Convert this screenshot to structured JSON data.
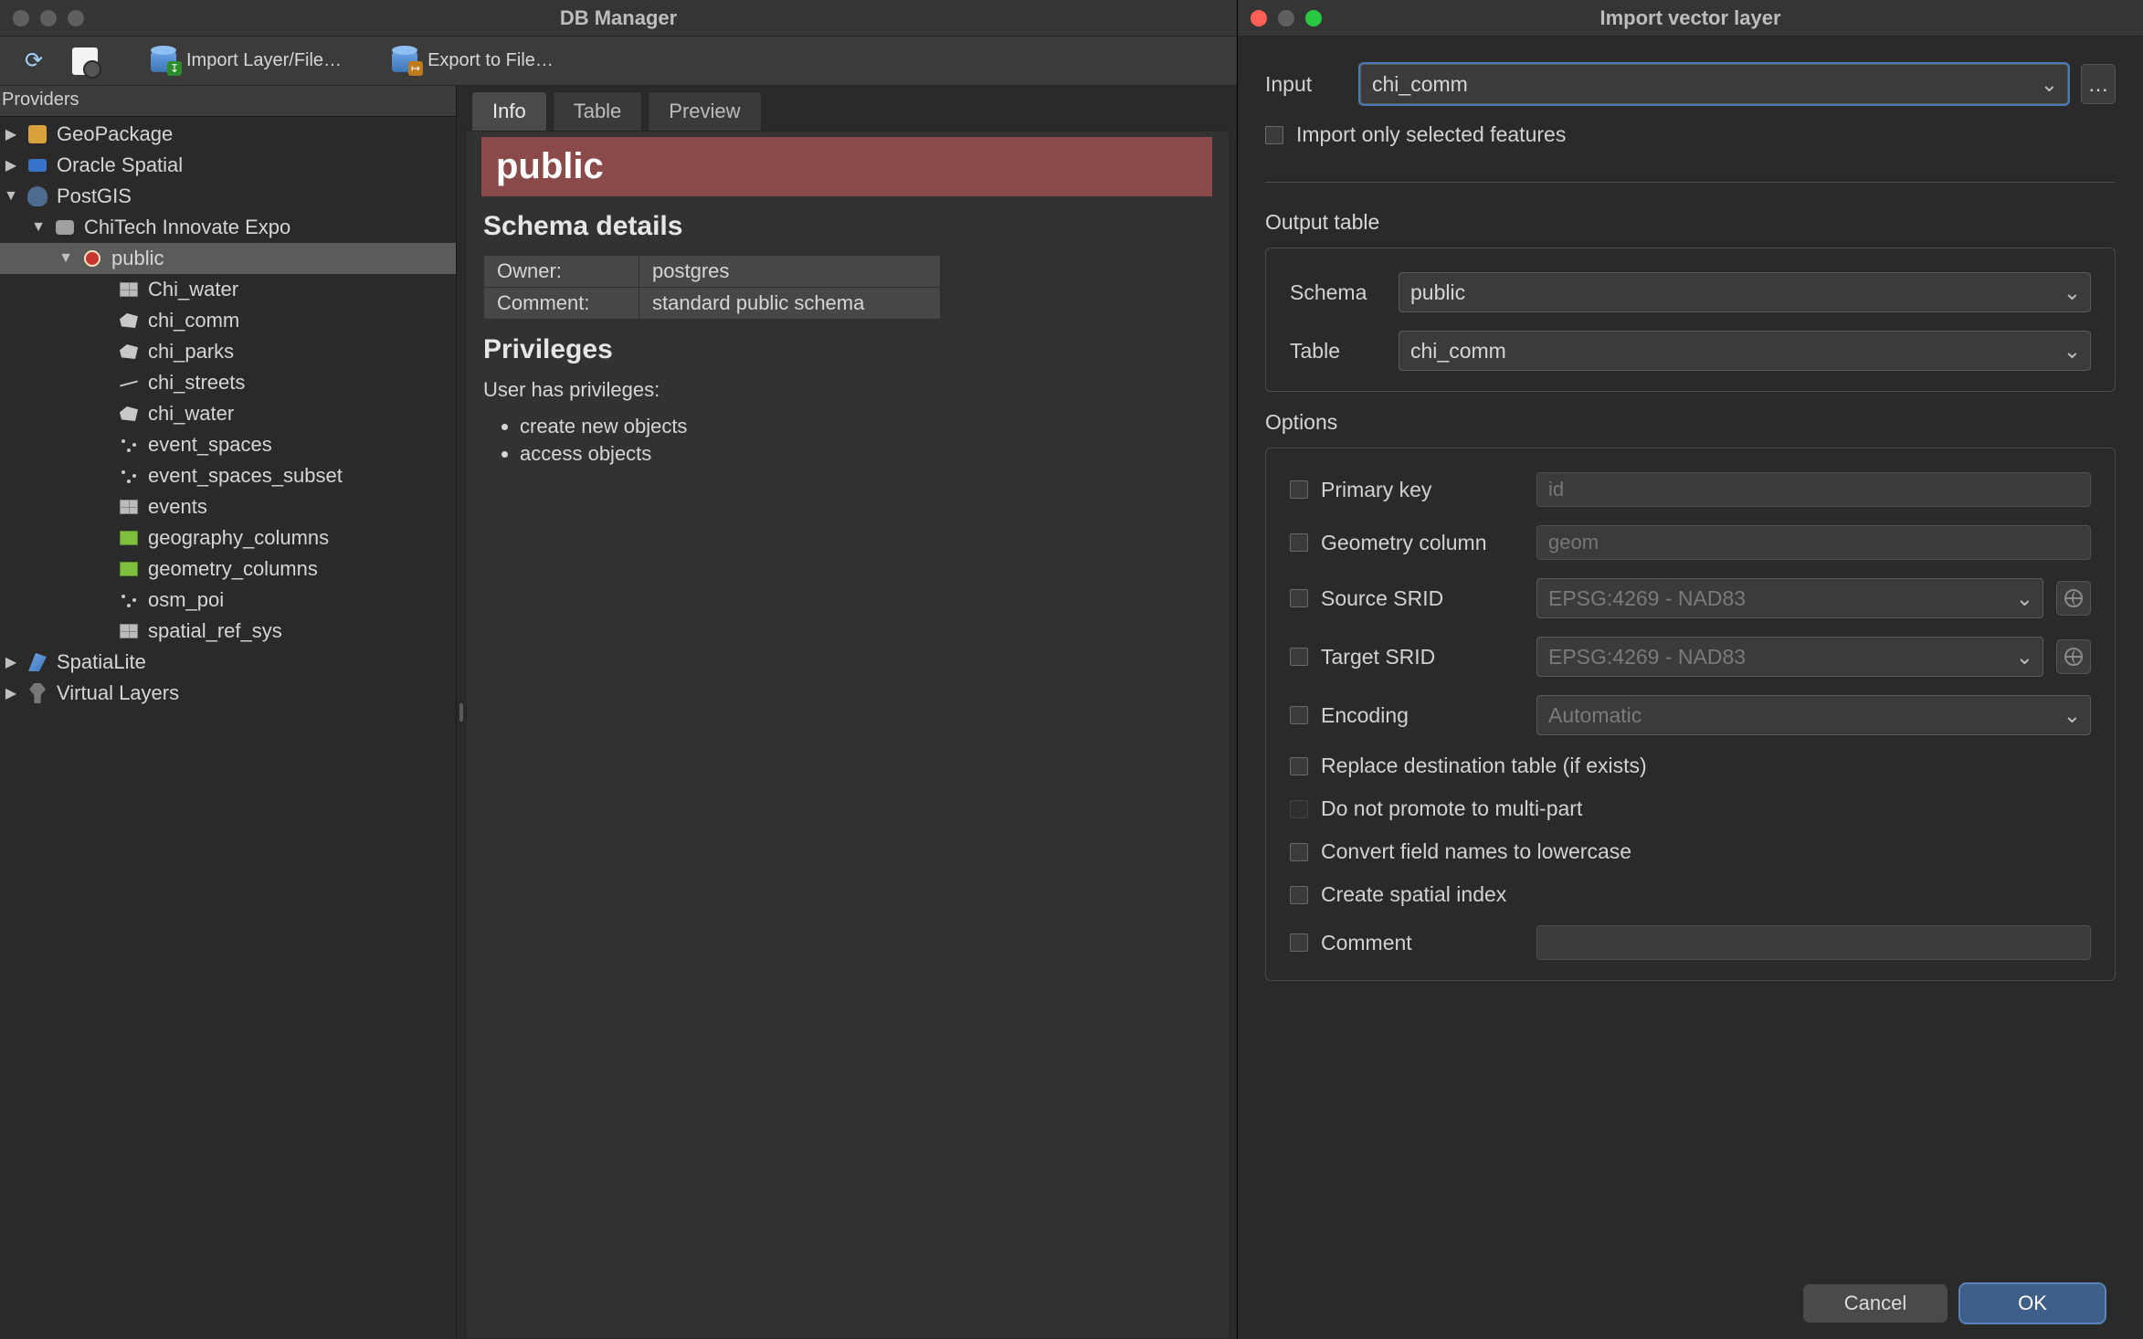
{
  "db_manager": {
    "title": "DB Manager",
    "toolbar": {
      "import": "Import Layer/File…",
      "export": "Export to File…"
    },
    "providers_header": "Providers",
    "tree": {
      "geopackage": "GeoPackage",
      "oracle": "Oracle Spatial",
      "postgis": "PostGIS",
      "connection": "ChiTech Innovate Expo",
      "schema": "public",
      "tables": {
        "t0": "Chi_water",
        "t1": "chi_comm",
        "t2": "chi_parks",
        "t3": "chi_streets",
        "t4": "chi_water",
        "t5": "event_spaces",
        "t6": "event_spaces_subset",
        "t7": "events",
        "t8": "geography_columns",
        "t9": "geometry_columns",
        "t10": "osm_poi",
        "t11": "spatial_ref_sys"
      },
      "spatialite": "SpatiaLite",
      "virtual": "Virtual Layers"
    },
    "tabs": {
      "info": "Info",
      "table": "Table",
      "preview": "Preview"
    },
    "info": {
      "schema_name": "public",
      "details_heading": "Schema details",
      "owner_key": "Owner:",
      "owner_val": "postgres",
      "comment_key": "Comment:",
      "comment_val": "standard public schema",
      "priv_heading": "Privileges",
      "priv_text": "User has privileges:",
      "priv_create": "create new objects",
      "priv_access": "access objects"
    }
  },
  "import": {
    "title": "Import vector layer",
    "input_label": "Input",
    "input_value": "chi_comm",
    "browse": "…",
    "only_selected": "Import only selected features",
    "output_heading": "Output table",
    "schema_label": "Schema",
    "schema_value": "public",
    "table_label": "Table",
    "table_value": "chi_comm",
    "options_heading": "Options",
    "primary_key": "Primary key",
    "primary_key_placeholder": "id",
    "geom_col": "Geometry column",
    "geom_col_placeholder": "geom",
    "source_srid": "Source SRID",
    "source_srid_value": "EPSG:4269 - NAD83",
    "target_srid": "Target SRID",
    "target_srid_value": "EPSG:4269 - NAD83",
    "encoding": "Encoding",
    "encoding_value": "Automatic",
    "replace": "Replace destination table (if exists)",
    "promote": "Do not promote to multi-part",
    "lowercase": "Convert field names to lowercase",
    "spatial_index": "Create spatial index",
    "comment": "Comment",
    "cancel": "Cancel",
    "ok": "OK"
  }
}
